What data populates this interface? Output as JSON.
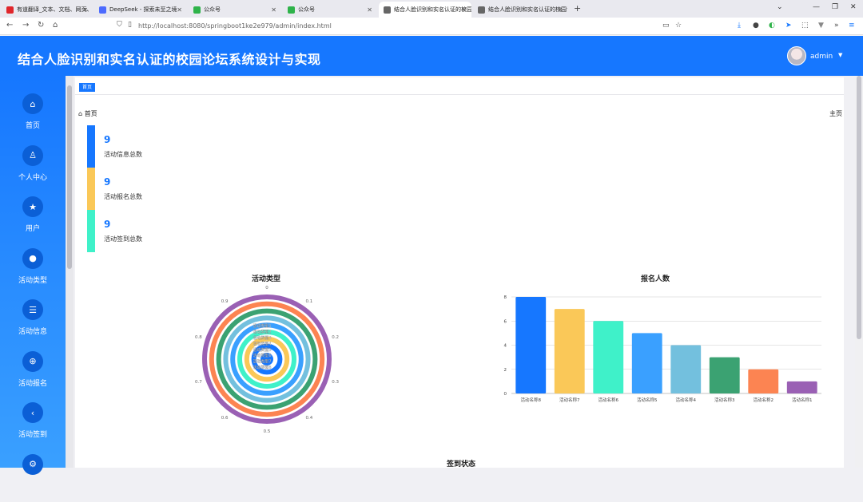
{
  "browser": {
    "tabs": [
      {
        "title": "有道翻译_文本、文档、网页、…",
        "color": "#e0262b"
      },
      {
        "title": "DeepSeek - 探索未至之境",
        "color": "#4d6bfe"
      },
      {
        "title": "公众号",
        "color": "#2fb34a"
      },
      {
        "title": "公众号",
        "color": "#2fb34a"
      },
      {
        "title": "结合人脸识别和实名认证的校园…",
        "color": "#666666"
      },
      {
        "title": "结合人脸识别和实名认证的校园论坛…",
        "color": "#666666"
      }
    ],
    "url": "http://localhost:8080/springboot1ke2e979/admin/index.html"
  },
  "header": {
    "title": "结合人脸识别和实名认证的校园论坛系统设计与实现",
    "user": "admin"
  },
  "sidebar": {
    "items": [
      {
        "label": "首页",
        "icon": "home-icon",
        "glyph": "⌂"
      },
      {
        "label": "个人中心",
        "icon": "user-icon",
        "glyph": "♙"
      },
      {
        "label": "用户",
        "icon": "star-icon",
        "glyph": "★"
      },
      {
        "label": "活动类型",
        "icon": "person-icon",
        "glyph": "●"
      },
      {
        "label": "活动信息",
        "icon": "list-icon",
        "glyph": "☰"
      },
      {
        "label": "活动报名",
        "icon": "arrow-circle-icon",
        "glyph": "⊕"
      },
      {
        "label": "活动签到",
        "icon": "chevron-left-icon",
        "glyph": "‹"
      },
      {
        "label": "",
        "icon": "user-settings-icon",
        "glyph": "⚙"
      }
    ]
  },
  "main": {
    "tag": "首页",
    "breadcrumb": "首页",
    "breadcrumb_right": "主页",
    "stats": [
      {
        "value": "9",
        "label": "活动信息总数",
        "color": "#1677ff"
      },
      {
        "value": "9",
        "label": "活动报名总数",
        "color": "#fac858"
      },
      {
        "value": "9",
        "label": "活动签到总数",
        "color": "#3ff1c9"
      }
    ]
  },
  "chart_data": [
    {
      "type": "polar-bar",
      "title": "活动类型",
      "angle_ticks": [
        "0",
        "0.1",
        "0.2",
        "0.3",
        "0.4",
        "0.5",
        "0.6",
        "0.7",
        "0.8",
        "0.9"
      ],
      "categories": [
        "活动类型1",
        "活动类型2",
        "活动类型3",
        "活动类型4",
        "活动类型5",
        "活动类型6",
        "活动类型7",
        "活动类型8"
      ],
      "values": [
        1,
        1,
        1,
        1,
        1,
        1,
        1,
        1
      ],
      "colors": [
        "#9a60b4",
        "#fc8452",
        "#3ba272",
        "#73c0de",
        "#3aa0ff",
        "#3ff1c9",
        "#fac858",
        "#1677ff"
      ]
    },
    {
      "type": "bar",
      "title": "报名人数",
      "categories": [
        "活动名称8",
        "活动名称7",
        "活动名称6",
        "活动名称5",
        "活动名称4",
        "活动名称3",
        "活动名称2",
        "活动名称1"
      ],
      "values": [
        8,
        7,
        6,
        5,
        4,
        3,
        2,
        1
      ],
      "colors": [
        "#1677ff",
        "#fac858",
        "#3ff1c9",
        "#3aa0ff",
        "#73c0de",
        "#3ba272",
        "#fc8452",
        "#9a60b4"
      ],
      "yticks": [
        "0",
        "2",
        "4",
        "6",
        "8"
      ],
      "ylim": [
        0,
        8
      ]
    }
  ],
  "section3": {
    "title": "签到状态"
  }
}
